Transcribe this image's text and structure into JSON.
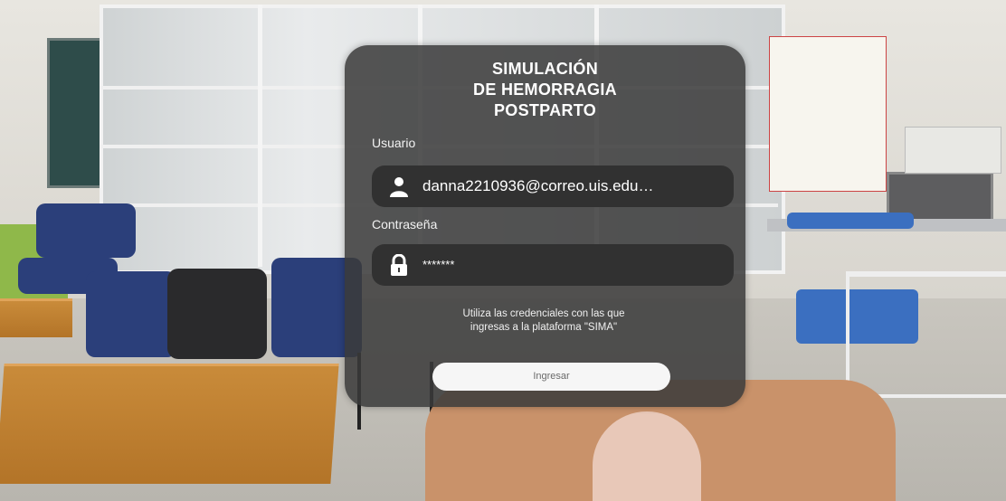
{
  "login": {
    "title_lines": [
      "SIMULACIÓN",
      "DE HEMORRAGIA",
      "POSTPARTO"
    ],
    "username_label": "Usuario",
    "username_value": "danna2210936@correo.uis.edu…",
    "username_icon": "user-icon",
    "password_label": "Contraseña",
    "password_value": "*******",
    "password_icon": "lock-icon",
    "hint_lines": [
      "Utiliza las credenciales con las que",
      "ingresas a la plataforma \"SIMA\""
    ],
    "submit_label": "Ingresar"
  }
}
